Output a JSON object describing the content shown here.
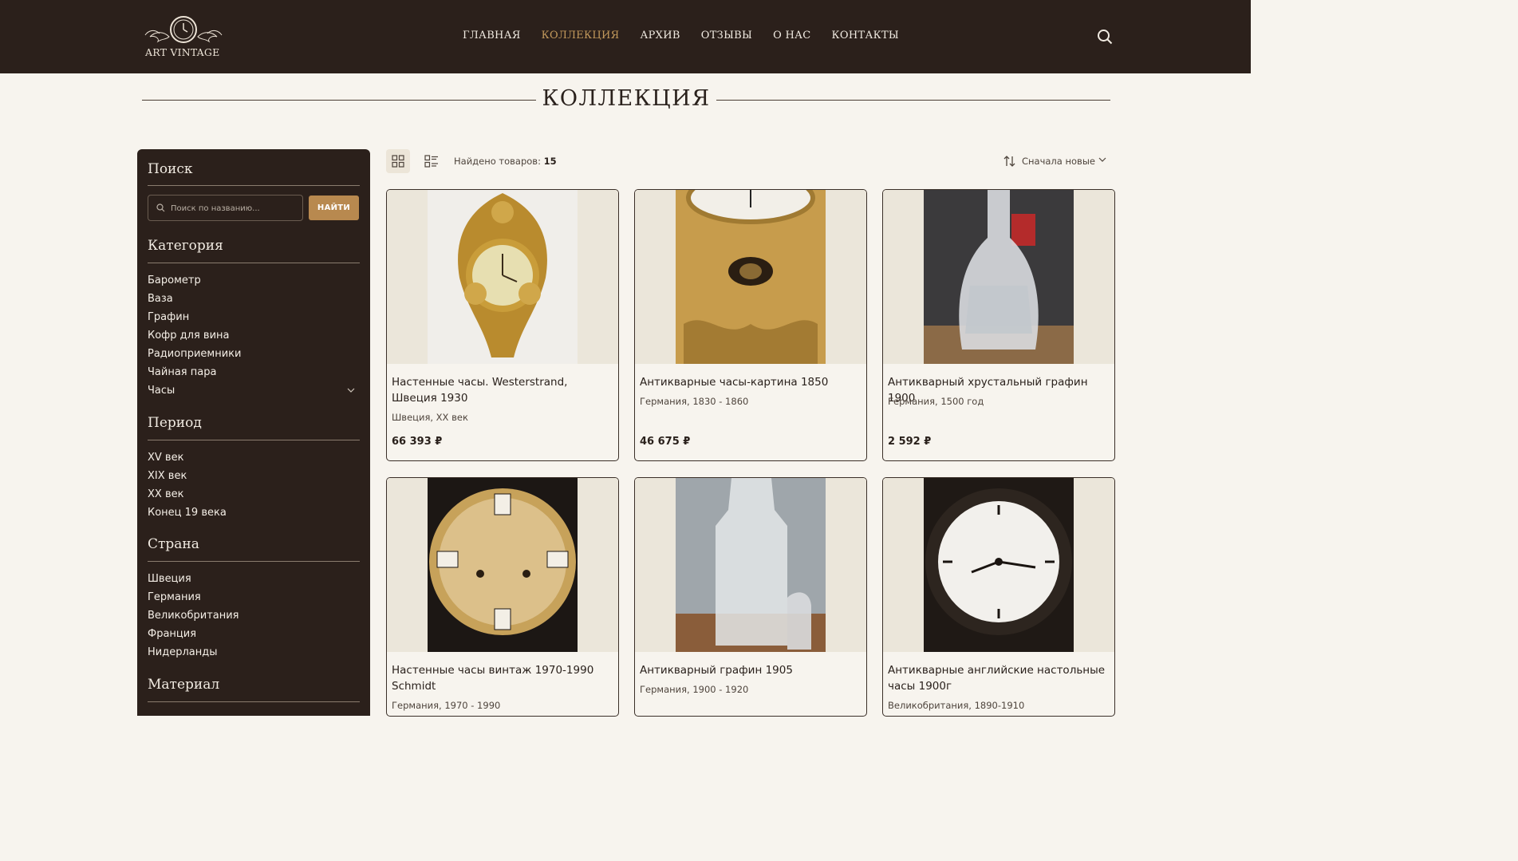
{
  "header": {
    "logo_text": "ART VINTAGE",
    "nav": [
      "ГЛАВНАЯ",
      "КОЛЛЕКЦИЯ",
      "АРХИВ",
      "ОТЗЫВЫ",
      "О НАС",
      "КОНТАКТЫ"
    ],
    "active_nav": "КОЛЛЕКЦИЯ"
  },
  "page_title": "КОЛЛЕКЦИЯ",
  "sidebar": {
    "search_heading": "Поиск",
    "search_placeholder": "Поиск по названию...",
    "search_button": "НАЙТИ",
    "category_heading": "Категория",
    "categories": [
      "Барометр",
      "Ваза",
      "Графин",
      "Кофр для вина",
      "Радиоприемники",
      "Чайная пара",
      "Часы"
    ],
    "period_heading": "Период",
    "periods": [
      "XV век",
      "XIX век",
      "XX век",
      "Конец 19 века"
    ],
    "country_heading": "Страна",
    "countries": [
      "Швеция",
      "Германия",
      "Великобритания",
      "Франция",
      "Нидерланды"
    ],
    "material_heading": "Материал"
  },
  "toolbar": {
    "found_label": "Найдено товаров:",
    "found_count": "15",
    "sort_label": "Сначала новые"
  },
  "products": [
    {
      "name": "Настенные часы. Westerstrand, Швеция 1930",
      "meta": "Швеция, XX век",
      "price": "66 393 ₽"
    },
    {
      "name": "Антикварные часы-картина 1850",
      "meta": "Германия, 1830 - 1860",
      "price": "46 675 ₽"
    },
    {
      "name": "Антикварный хрустальный графин 1900",
      "meta": "Германия, 1500 год",
      "price": "2 592 ₽"
    },
    {
      "name": "Настенные часы винтаж 1970-1990 Schmidt",
      "meta": "Германия, 1970 - 1990",
      "price": ""
    },
    {
      "name": "Антикварный графин 1905",
      "meta": "Германия, 1900 - 1920",
      "price": ""
    },
    {
      "name": "Антикварные английские настольные часы 1900г",
      "meta": "Великобритания, 1890-1910",
      "price": ""
    }
  ],
  "colors": {
    "header_bg": "#2b201b",
    "accent": "#c49a5c",
    "button": "#b8894f",
    "page_bg": "#f7f4ee"
  }
}
